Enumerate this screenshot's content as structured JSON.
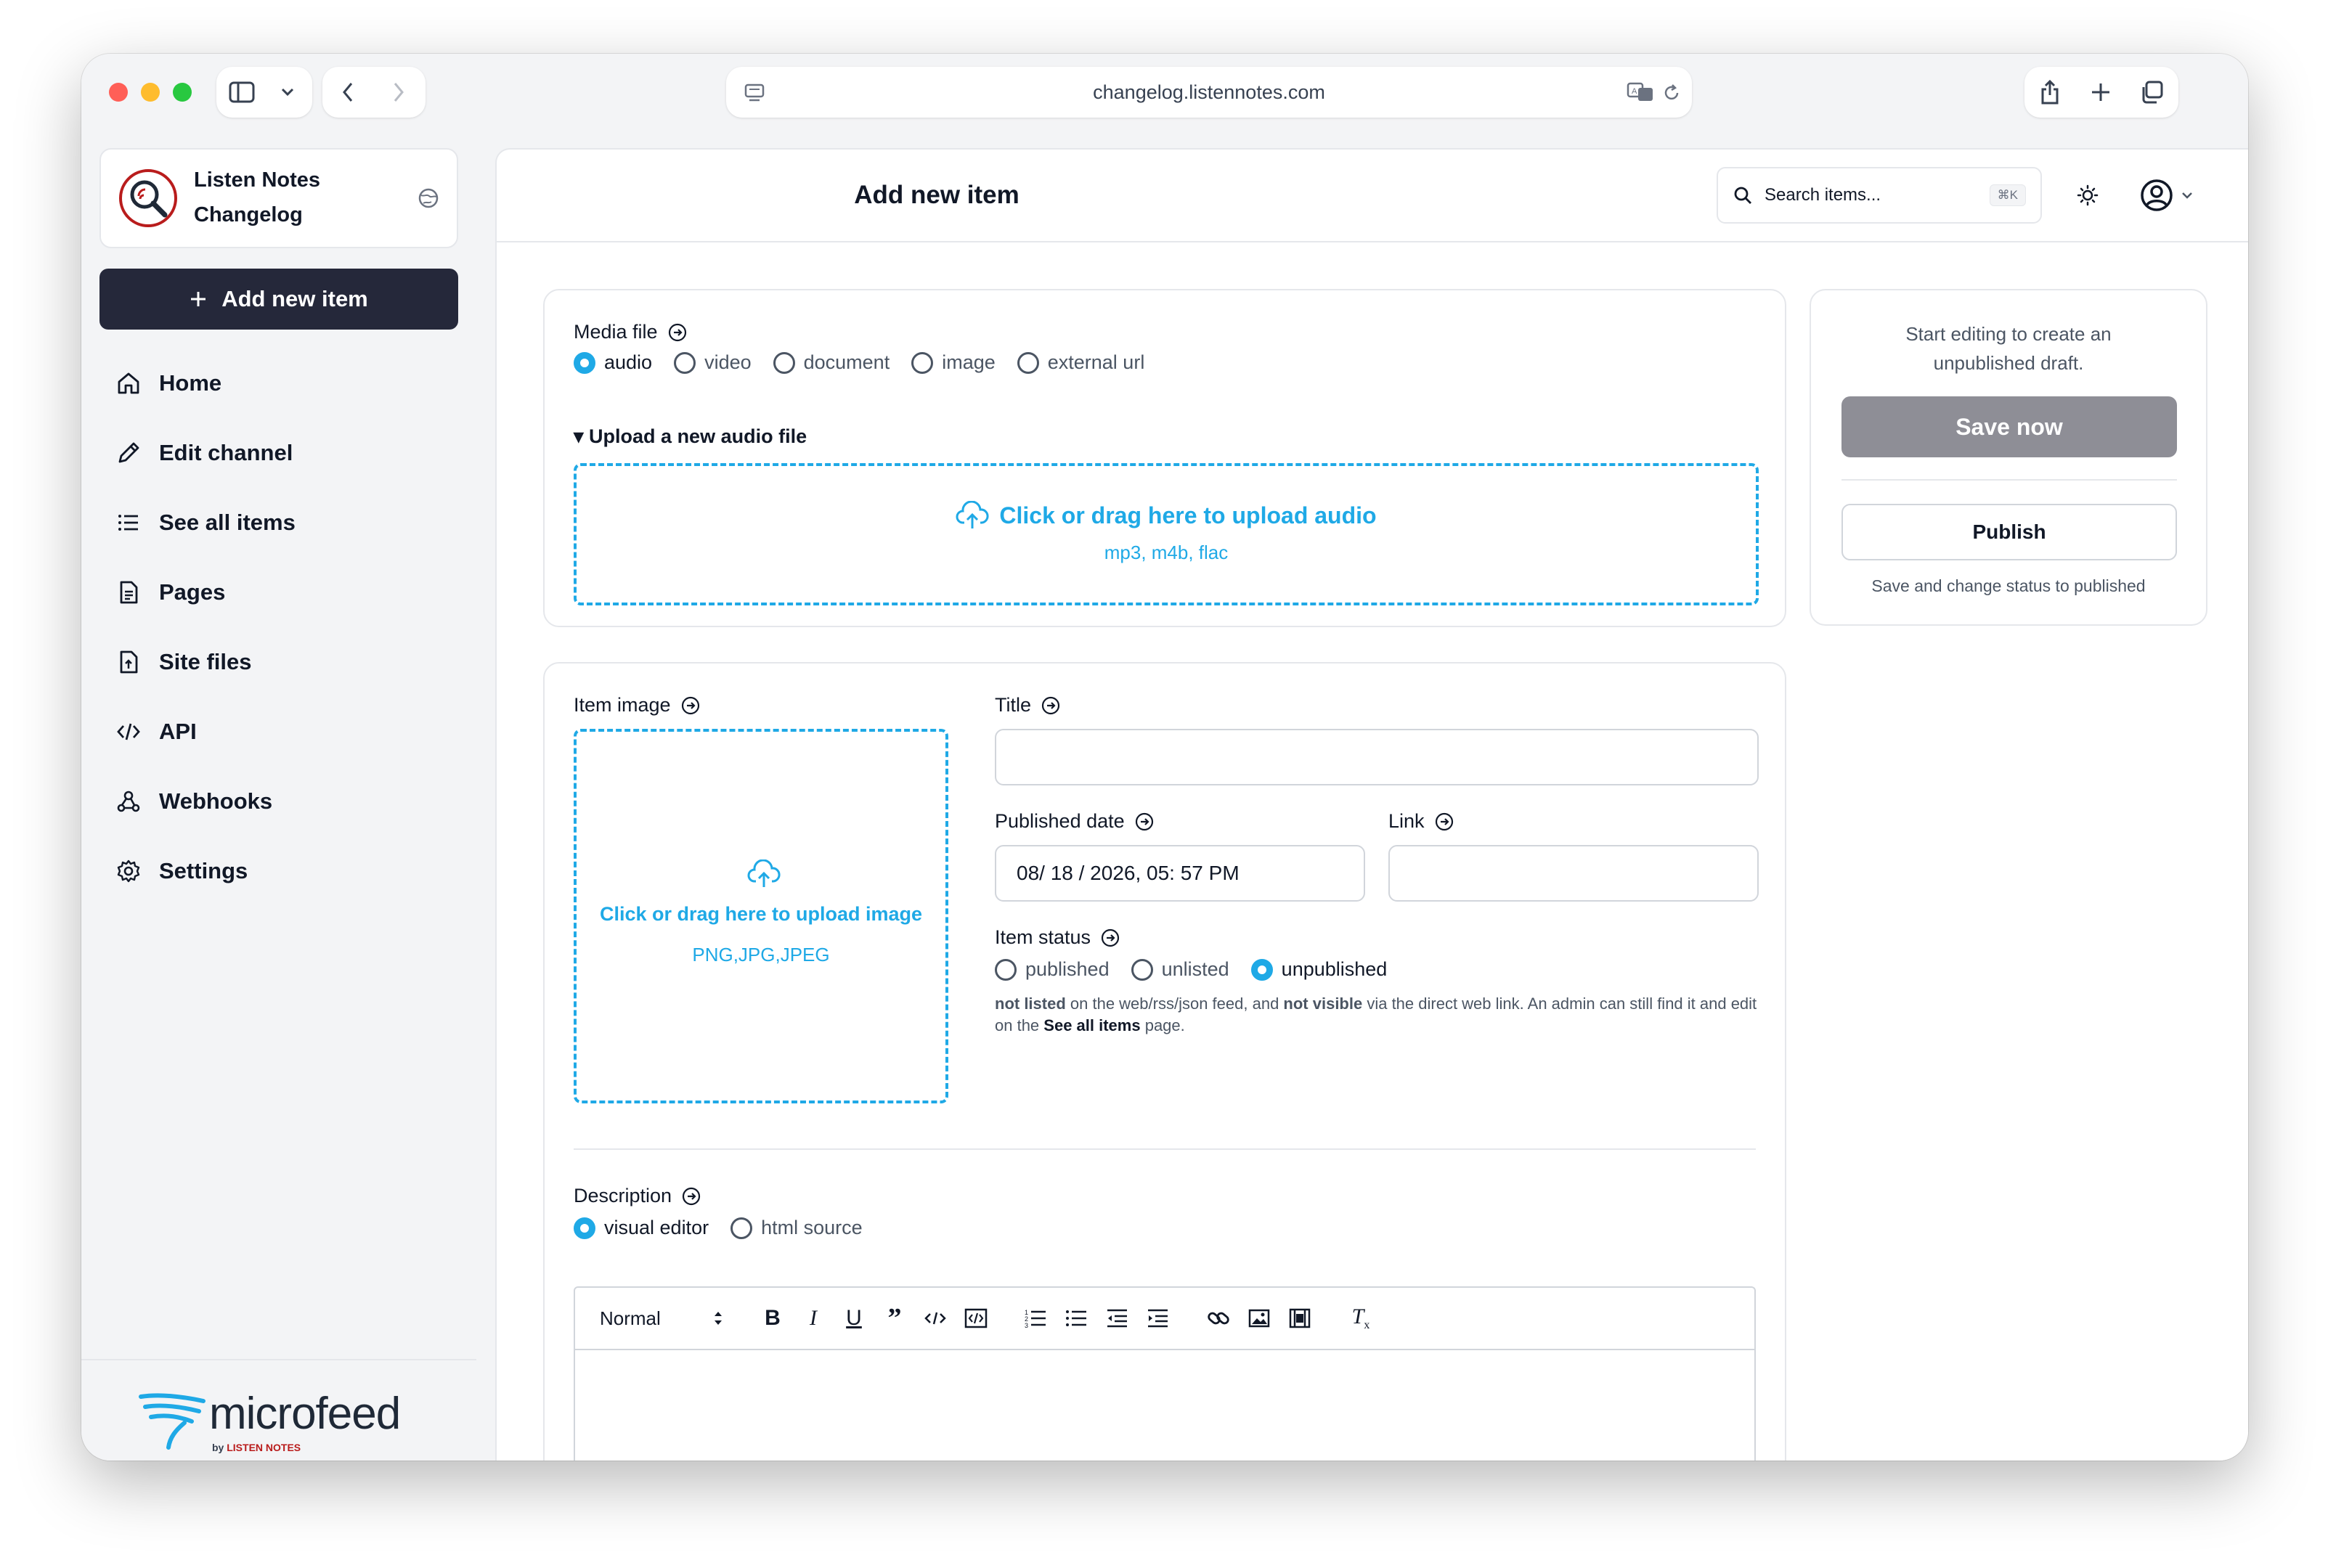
{
  "browser": {
    "url": "changelog.listennotes.com"
  },
  "sidebar": {
    "brand_line1": "Listen Notes",
    "brand_line2": "Changelog",
    "add_button": "Add new item",
    "items": [
      {
        "label": "Home",
        "icon": "home-icon"
      },
      {
        "label": "Edit channel",
        "icon": "pencil-icon"
      },
      {
        "label": "See all items",
        "icon": "list-icon"
      },
      {
        "label": "Pages",
        "icon": "document-icon"
      },
      {
        "label": "Site files",
        "icon": "file-icon"
      },
      {
        "label": "API",
        "icon": "code-icon"
      },
      {
        "label": "Webhooks",
        "icon": "webhook-icon"
      },
      {
        "label": "Settings",
        "icon": "gear-icon"
      }
    ],
    "logo_text": "microfeed",
    "logo_by": "by",
    "logo_brand": "LISTEN NOTES"
  },
  "header": {
    "title": "Add new item",
    "search_placeholder": "Search items...",
    "search_shortcut": "⌘K"
  },
  "media": {
    "label": "Media file",
    "options": [
      {
        "label": "audio",
        "selected": true
      },
      {
        "label": "video",
        "selected": false
      },
      {
        "label": "document",
        "selected": false
      },
      {
        "label": "image",
        "selected": false
      },
      {
        "label": "external url",
        "selected": false
      }
    ],
    "upload_title": "▾ Upload a new audio file",
    "dropzone_title": "Click or drag here to upload audio",
    "dropzone_formats": "mp3, m4b, flac"
  },
  "details": {
    "image_label": "Item image",
    "image_dropzone_title": "Click or drag here to upload image",
    "image_dropzone_formats": "PNG,JPG,JPEG",
    "title_label": "Title",
    "title_value": "",
    "date_label": "Published date",
    "date_value": "08/ 18 / 2026, 05: 57 PM",
    "link_label": "Link",
    "link_value": "",
    "status_label": "Item status",
    "status_options": [
      {
        "label": "published",
        "selected": false
      },
      {
        "label": "unlisted",
        "selected": false
      },
      {
        "label": "unpublished",
        "selected": true
      }
    ],
    "status_help": {
      "b1": "not listed",
      "t1": " on the web/rss/json feed, and ",
      "b2": "not visible",
      "t2": " via the direct web link. An admin can still find it and edit on the ",
      "b3": "See all items",
      "t3": " page."
    },
    "description_label": "Description",
    "editor_modes": [
      {
        "label": "visual editor",
        "selected": true
      },
      {
        "label": "html source",
        "selected": false
      }
    ],
    "format_select": "Normal"
  },
  "publish_panel": {
    "hint": "Start editing to create an unpublished draft.",
    "save_button": "Save now",
    "publish_button": "Publish",
    "publish_hint": "Save and change status to published"
  },
  "colors": {
    "accent": "#1fa9e6",
    "primary_button": "#25283a",
    "disabled_button": "#8e8e96"
  }
}
